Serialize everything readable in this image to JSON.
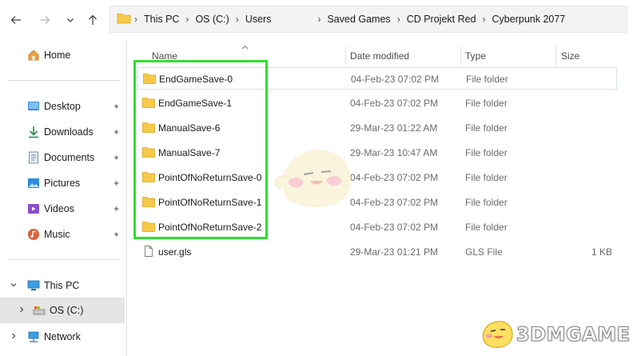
{
  "address": {
    "crumbs": [
      "This PC",
      "OS (C:)",
      "Users",
      "Saved Games",
      "CD Projekt Red",
      "Cyberpunk 2077"
    ]
  },
  "sidebar": {
    "home": "Home",
    "pinned": [
      "Desktop",
      "Downloads",
      "Documents",
      "Pictures",
      "Videos",
      "Music"
    ],
    "this_pc": "This PC",
    "drive": "OS (C:)",
    "network": "Network"
  },
  "columns": {
    "name": "Name",
    "date": "Date modified",
    "type": "Type",
    "size": "Size"
  },
  "files": [
    {
      "name": "EndGameSave-0",
      "date": "04-Feb-23 07:02 PM",
      "type": "File folder",
      "size": "",
      "icon": "folder-icon"
    },
    {
      "name": "EndGameSave-1",
      "date": "04-Feb-23 07:02 PM",
      "type": "File folder",
      "size": "",
      "icon": "folder-icon"
    },
    {
      "name": "ManualSave-6",
      "date": "29-Mar-23 01:22 AM",
      "type": "File folder",
      "size": "",
      "icon": "folder-icon"
    },
    {
      "name": "ManualSave-7",
      "date": "29-Mar-23 10:47 AM",
      "type": "File folder",
      "size": "",
      "icon": "folder-icon"
    },
    {
      "name": "PointOfNoReturnSave-0",
      "date": "04-Feb-23 07:02 PM",
      "type": "File folder",
      "size": "",
      "icon": "folder-icon"
    },
    {
      "name": "PointOfNoReturnSave-1",
      "date": "04-Feb-23 07:02 PM",
      "type": "File folder",
      "size": "",
      "icon": "folder-icon"
    },
    {
      "name": "PointOfNoReturnSave-2",
      "date": "04-Feb-23 07:02 PM",
      "type": "File folder",
      "size": "",
      "icon": "folder-icon"
    },
    {
      "name": "user.gls",
      "date": "29-Mar-23 01:21 PM",
      "type": "GLS File",
      "size": "1 KB",
      "icon": "file-icon"
    }
  ],
  "watermark": {
    "text": "3DMGAME"
  },
  "colors": {
    "highlight": "#2fe02f",
    "folder": "#f7c948",
    "accent": "#0067c0"
  }
}
